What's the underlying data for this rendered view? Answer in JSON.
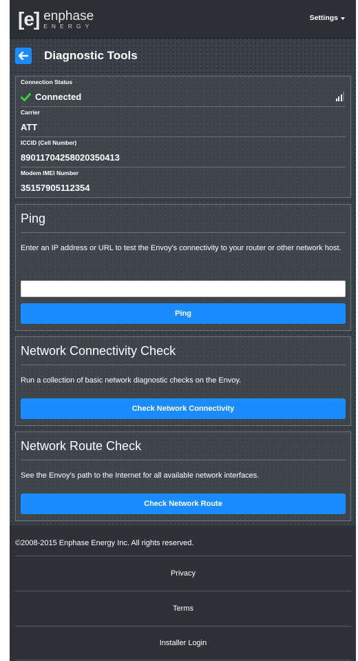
{
  "header": {
    "logo_mark": "[e]",
    "logo_brand": "enphase",
    "logo_sub": "ENERGY",
    "settings_label": "Settings"
  },
  "page": {
    "title": "Diagnostic Tools"
  },
  "status": {
    "connection_label": "Connection Status",
    "connection_value": "Connected",
    "carrier_label": "Carrier",
    "carrier_value": "ATT",
    "iccid_label": "ICCID (Cell Number)",
    "iccid_value": "89011704258020350413",
    "imei_label": "Modem IMEI Number",
    "imei_value": "35157905112354",
    "signal_bars_active": 3,
    "signal_bars_total": 4
  },
  "ping": {
    "title": "Ping",
    "description": "Enter an IP address or URL to test the Envoy's connectivity to your router or other network host.",
    "input_value": "",
    "button_label": "Ping"
  },
  "connectivity": {
    "title": "Network Connectivity Check",
    "description": "Run a collection of basic network diagnostic checks on the Envoy.",
    "button_label": "Check Network Connectivity"
  },
  "route": {
    "title": "Network Route Check",
    "description": "See the Envoy's path to the Internet for all available network interfaces.",
    "button_label": "Check Network Route"
  },
  "footer": {
    "copyright": "©2008-2015 Enphase Energy Inc. All rights reserved.",
    "links": [
      "Privacy",
      "Terms",
      "Installer Login"
    ]
  },
  "colors": {
    "accent": "#1a8cff",
    "check": "#3dd13d",
    "background": "#3b4148"
  }
}
